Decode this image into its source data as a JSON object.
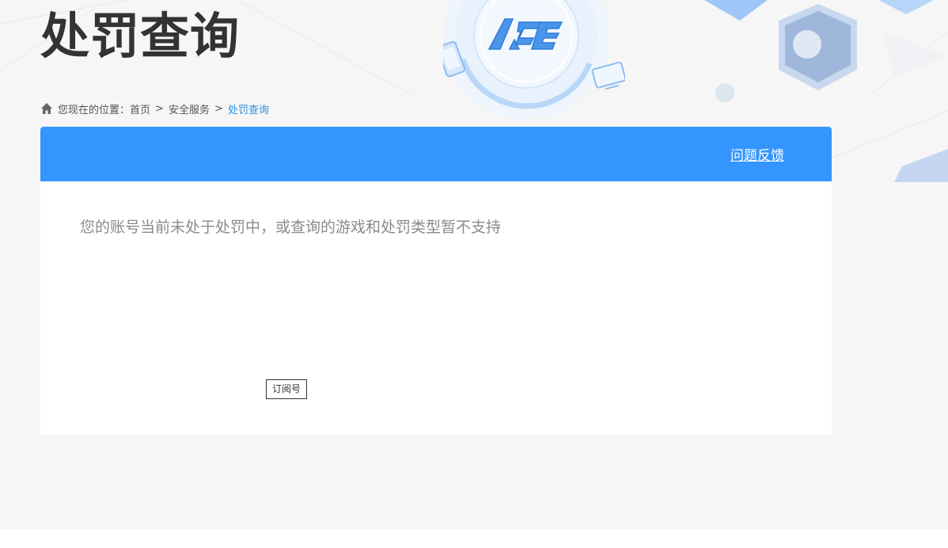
{
  "header": {
    "title": "处罚查询"
  },
  "breadcrumb": {
    "prefix": "您现在的位置：",
    "items": [
      "首页",
      "安全服务",
      "处罚查询"
    ],
    "separator": ">"
  },
  "panel": {
    "feedback_link": "问题反馈",
    "message": "您的账号当前未处于处罚中，或查询的游戏和处罚类型暂不支持",
    "subscribe_label": "订阅号"
  },
  "colors": {
    "accent": "#3595fe",
    "breadcrumb_current": "#2b8fe0",
    "background": "#f6f6f6"
  },
  "icons": {
    "home": "home-icon",
    "logo": "ace-logo"
  }
}
